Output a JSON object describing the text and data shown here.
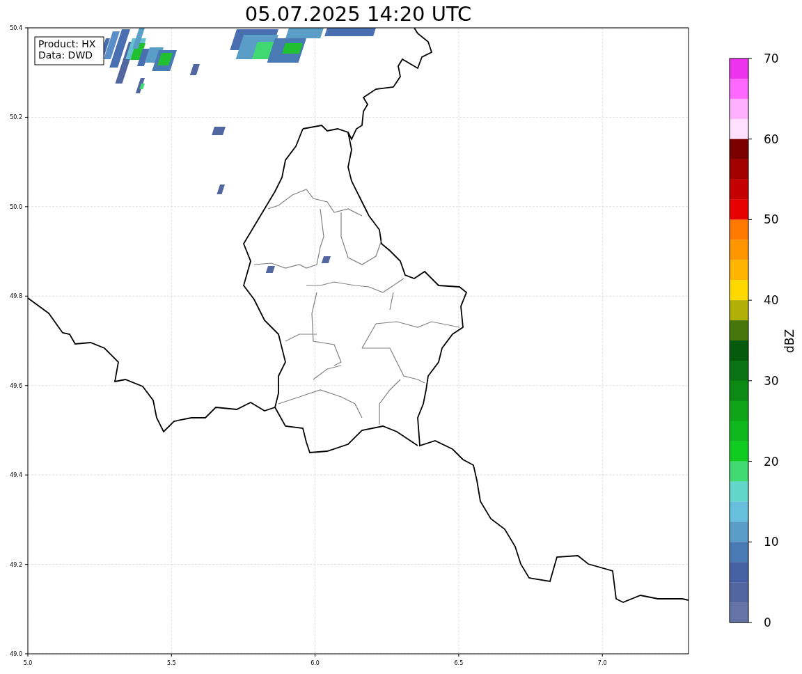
{
  "title": "05.07.2025 14:20 UTC",
  "info_box": [
    "Product: HX",
    "Data: DWD"
  ],
  "x_axis": {
    "ticks": [
      "5.0",
      "5.5",
      "6.0",
      "6.5",
      "7.0"
    ]
  },
  "y_axis": {
    "ticks": [
      "50.4",
      "50.2",
      "50.0",
      "49.8",
      "49.6",
      "49.4",
      "49.2",
      "49.0"
    ]
  },
  "colorbar": {
    "label": "dBZ",
    "ticks": [
      "70",
      "60",
      "50",
      "40",
      "30",
      "20",
      "10",
      "0"
    ],
    "bands": [
      {
        "color": "#ee33ee"
      },
      {
        "color": "#ff68ff"
      },
      {
        "color": "#ffb0ff"
      },
      {
        "color": "#ffe0ff"
      },
      {
        "color": "#7a0000"
      },
      {
        "color": "#a20000"
      },
      {
        "color": "#c40000"
      },
      {
        "color": "#e60000"
      },
      {
        "color": "#ff7800"
      },
      {
        "color": "#ff9600"
      },
      {
        "color": "#ffb400"
      },
      {
        "color": "#ffd800"
      },
      {
        "color": "#b0b006"
      },
      {
        "color": "#47760a"
      },
      {
        "color": "#065a0c"
      },
      {
        "color": "#0a7414"
      },
      {
        "color": "#0c8a14"
      },
      {
        "color": "#0ea618"
      },
      {
        "color": "#10b820"
      },
      {
        "color": "#10cc20"
      },
      {
        "color": "#40d870"
      },
      {
        "color": "#62d6c8"
      },
      {
        "color": "#66c0dd"
      },
      {
        "color": "#5a9ec8"
      },
      {
        "color": "#4a7ab3"
      },
      {
        "color": "#4560a3"
      },
      {
        "color": "#5267a0"
      },
      {
        "color": "#6474a6"
      }
    ]
  }
}
